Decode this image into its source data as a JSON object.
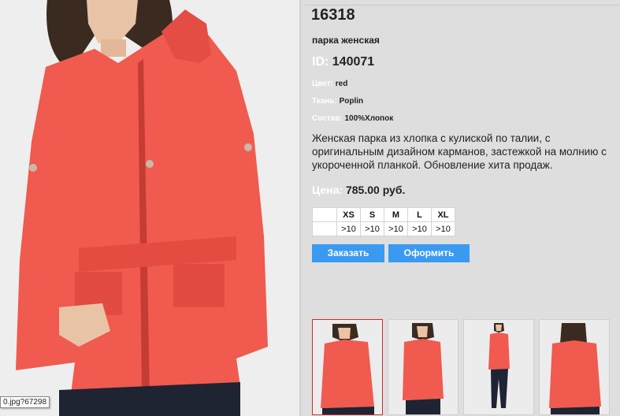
{
  "product": {
    "article": "16318",
    "title": "парка женская",
    "id_label": "ID:",
    "id_value": "140071",
    "attributes": [
      {
        "label": "Цвет:",
        "value": "red"
      },
      {
        "label": "Ткань:",
        "value": "Poplin"
      },
      {
        "label": "Состав:",
        "value": "100%Хлопок"
      }
    ],
    "description": "Женская парка из хлопка с кулиской по талии, с оригинальным дизайном карманов, застежкой на молнию с укороченной планкой. Обновление хита продаж.",
    "price_label": "Цена:",
    "price_value": "785.00 руб."
  },
  "sizes": {
    "headers": [
      "XS",
      "S",
      "M",
      "L",
      "XL"
    ],
    "stock": [
      ">10",
      ">10",
      ">10",
      ">10",
      ">10"
    ]
  },
  "buttons": {
    "order": "Заказать",
    "checkout": "Оформить"
  },
  "tooltip": "0.jpg?67298",
  "colors": {
    "button": "#3a9af2",
    "jacket": "#f05a4f",
    "selected_thumb_border": "#cc2c2c",
    "panel_bg": "#dedede"
  }
}
